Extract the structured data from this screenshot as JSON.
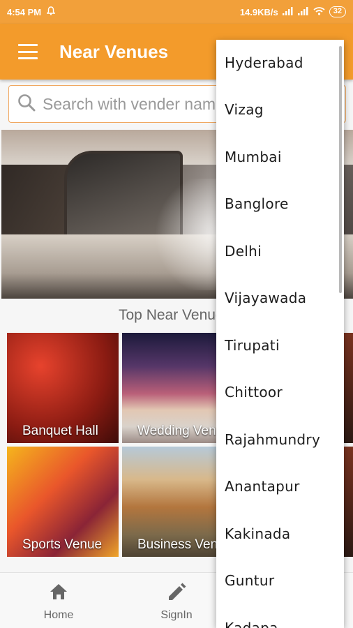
{
  "status_bar": {
    "time": "4:54 PM",
    "net_speed": "14.9KB/s",
    "battery": "32"
  },
  "toolbar": {
    "title": "Near Venues"
  },
  "search": {
    "placeholder": "Search with vender name"
  },
  "section": {
    "title": "Top Near Venues"
  },
  "tiles": [
    {
      "label": "Banquet Hall"
    },
    {
      "label": "Wedding Venue"
    },
    {
      "label": "Sports Venue"
    },
    {
      "label": "Business Venue"
    }
  ],
  "bottom_nav": {
    "items": [
      {
        "label": "Home",
        "icon": "home-icon"
      },
      {
        "label": "SignIn",
        "icon": "pencil-icon"
      }
    ]
  },
  "city_dropdown": {
    "items": [
      "Hyderabad",
      "Vizag",
      "Mumbai",
      "Banglore",
      "Delhi",
      "Vijayawada",
      "Tirupati",
      "Chittoor",
      "Rajahmundry",
      "Anantapur",
      "Kakinada",
      "Guntur",
      "Kadapa"
    ]
  },
  "colors": {
    "primary": "#f39b2b",
    "status_bar": "#f2a03a"
  }
}
